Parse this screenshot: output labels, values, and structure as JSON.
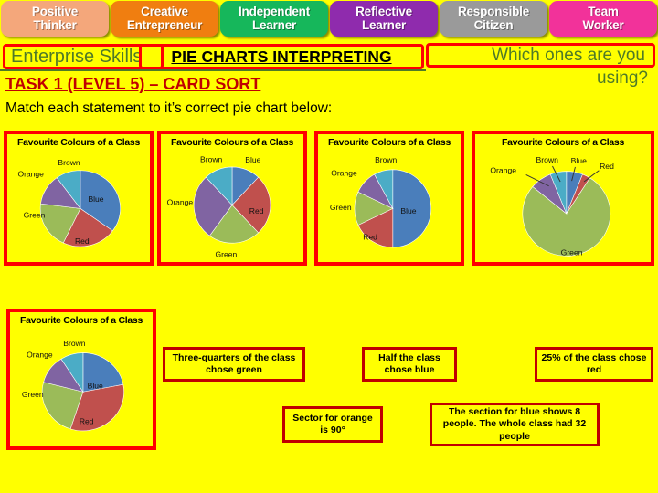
{
  "header": {
    "tabs": [
      {
        "line1": "Positive",
        "line2": "Thinker",
        "color": "#F4A77B"
      },
      {
        "line1": "Creative",
        "line2": "Entrepreneur",
        "color": "#F07E10"
      },
      {
        "line1": "Independent",
        "line2": "Learner",
        "color": "#16B75B"
      },
      {
        "line1": "Reflective",
        "line2": "Learner",
        "color": "#8F2BAD"
      },
      {
        "line1": "Responsible",
        "line2": "Citizen",
        "color": "#9A9A9A"
      },
      {
        "line1": "Team",
        "line2": "Worker",
        "color": "#F2329A"
      }
    ]
  },
  "title": {
    "enterprise_skills": "Enterprise Skills",
    "main_heading": "PIE CHARTS INTERPRETING",
    "which_line1": "Which ones are you",
    "which_line2": "using?",
    "task": "TASK 1 (LEVEL 5) – CARD SORT",
    "instruction": "Match each statement to it’s correct pie chart below:"
  },
  "colors": {
    "background": "#FFFF00",
    "box_border_red": "#FF0000",
    "statement_border": "#C00000",
    "green_text": "#4F7A28",
    "task_red": "#C00000",
    "blue_slice": "#4A7EBB",
    "red_slice": "#C0504D",
    "green_slice": "#9BBB59",
    "orange_slice": "#8064A2",
    "brown_slice": "#4BACC6"
  },
  "chart_data": [
    {
      "id": "chart-1",
      "type": "pie",
      "title": "Favourite Colours of a Class",
      "categories": [
        "Blue",
        "Red",
        "Green",
        "Orange",
        "Brown"
      ],
      "values": [
        35,
        22,
        20,
        13,
        10
      ],
      "colors": [
        "#4A7EBB",
        "#C0504D",
        "#9BBB59",
        "#8064A2",
        "#4BACC6"
      ],
      "legend": "labels-outside"
    },
    {
      "id": "chart-2",
      "type": "pie",
      "title": "Favourite Colours of a Class",
      "categories": [
        "Blue",
        "Red",
        "Green",
        "Orange",
        "Brown"
      ],
      "values": [
        12,
        26,
        22,
        28,
        12
      ],
      "colors": [
        "#4A7EBB",
        "#C0504D",
        "#9BBB59",
        "#8064A2",
        "#4BACC6"
      ],
      "legend": "labels-outside"
    },
    {
      "id": "chart-3",
      "type": "pie",
      "title": "Favourite Colours of a Class",
      "categories": [
        "Blue",
        "Red",
        "Green",
        "Orange",
        "Brown"
      ],
      "values": [
        50,
        18,
        14,
        10,
        8
      ],
      "colors": [
        "#4A7EBB",
        "#C0504D",
        "#9BBB59",
        "#8064A2",
        "#4BACC6"
      ],
      "legend": "labels-outside"
    },
    {
      "id": "chart-4",
      "type": "pie",
      "title": "Favourite Colours of a Class",
      "categories": [
        "Blue",
        "Red",
        "Green",
        "Orange",
        "Brown"
      ],
      "values": [
        6,
        3,
        77,
        8,
        6
      ],
      "colors": [
        "#4A7EBB",
        "#C0504D",
        "#9BBB59",
        "#8064A2",
        "#4BACC6"
      ],
      "legend": "labels-outside"
    },
    {
      "id": "chart-5",
      "type": "pie",
      "title": "Favourite Colours of a Class",
      "categories": [
        "Blue",
        "Red",
        "Green",
        "Orange",
        "Brown"
      ],
      "values": [
        22,
        33,
        24,
        12,
        9
      ],
      "colors": [
        "#4A7EBB",
        "#C0504D",
        "#9BBB59",
        "#8064A2",
        "#4BACC6"
      ],
      "legend": "labels-outside"
    }
  ],
  "statements": [
    {
      "id": "stmt-three-quarters-green",
      "text": "Three-quarters of the class chose green"
    },
    {
      "id": "stmt-half-blue",
      "text": "Half the class chose blue"
    },
    {
      "id": "stmt-25-red",
      "text": "25%  of the class chose red"
    },
    {
      "id": "stmt-orange-90",
      "text": "Sector for orange is 90°"
    },
    {
      "id": "stmt-blue-8-of-32",
      "text": "The section for blue shows 8 people. The whole class had 32 people"
    }
  ]
}
